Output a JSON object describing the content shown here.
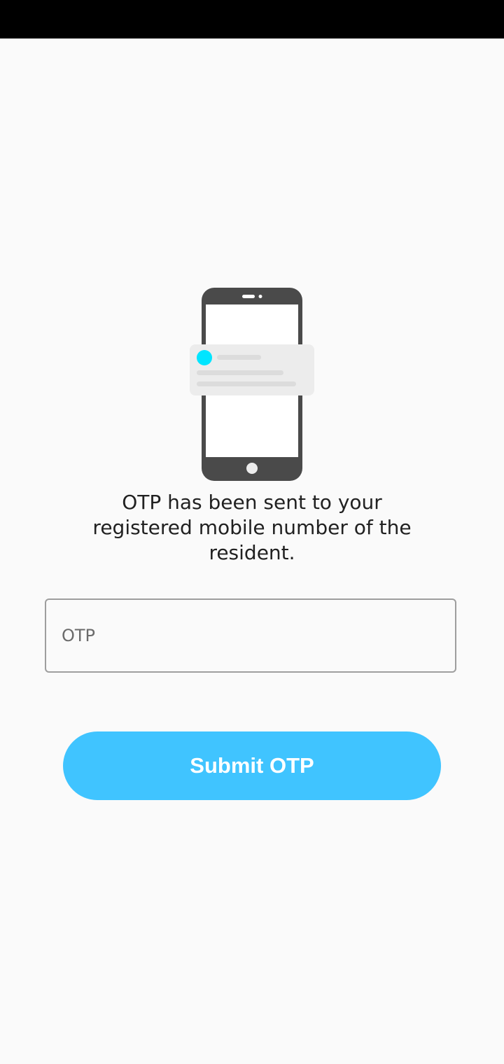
{
  "message": "OTP has been sent to your registered mobile number of the resident.",
  "otp_input": {
    "value": "",
    "placeholder": "OTP"
  },
  "submit_button": {
    "label": "Submit OTP"
  },
  "illustration": {
    "icon": "phone-notification-icon",
    "accent_color": "#00e5ff",
    "phone_color": "#4a4a4a"
  },
  "colors": {
    "button": "#40c4ff",
    "background": "#fafafa",
    "status_bar": "#000000"
  }
}
